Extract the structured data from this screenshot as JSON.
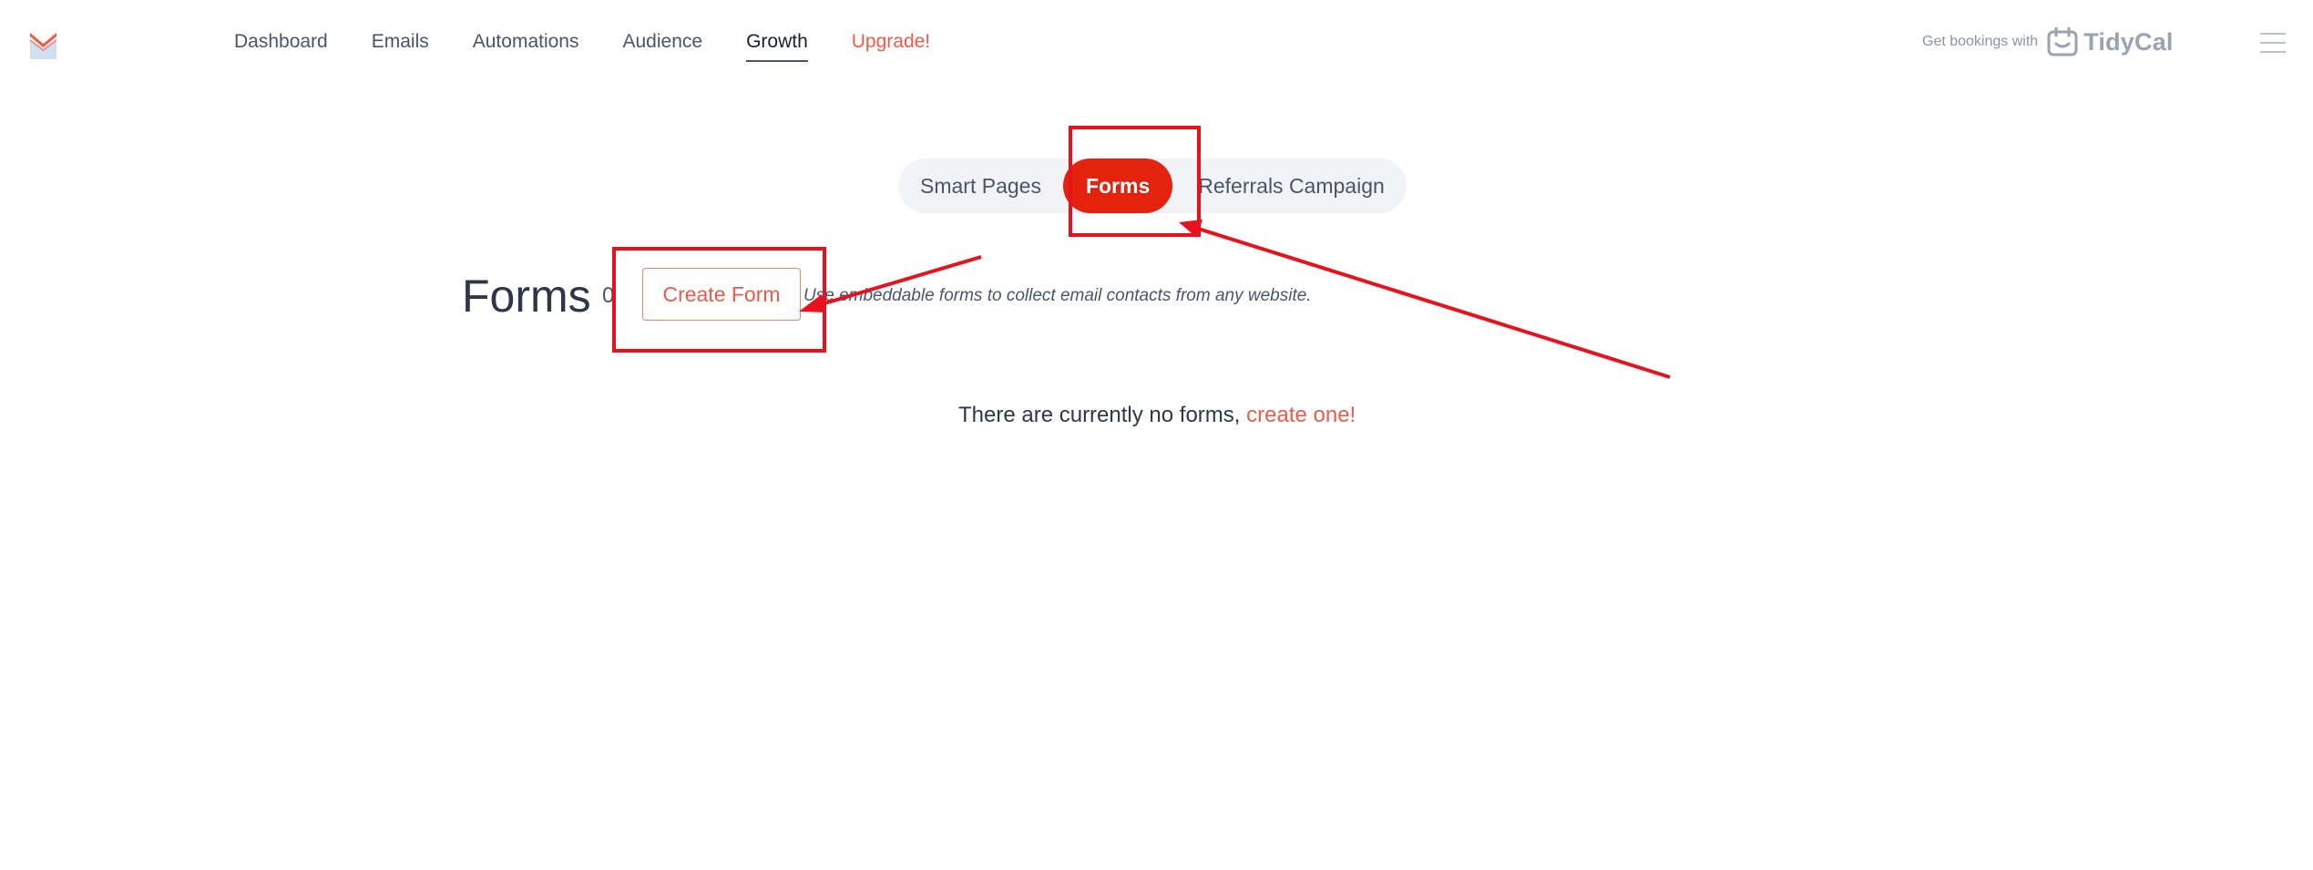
{
  "nav": {
    "items": [
      {
        "label": "Dashboard"
      },
      {
        "label": "Emails"
      },
      {
        "label": "Automations"
      },
      {
        "label": "Audience"
      },
      {
        "label": "Growth"
      },
      {
        "label": "Upgrade!"
      }
    ],
    "active": "Growth"
  },
  "tidycal": {
    "prefix": "Get bookings with",
    "brand": "TidyCal",
    "icon": "calendar-icon"
  },
  "tabs": [
    {
      "label": "Smart Pages"
    },
    {
      "label": "Forms"
    },
    {
      "label": "Referrals Campaign"
    }
  ],
  "main": {
    "title": "Forms",
    "count": "0",
    "create_button": "Create Form",
    "description": "Use embeddable forms to collect email contacts from any website.",
    "empty_text": "There are currently no forms,",
    "empty_link": "create one!"
  },
  "colors": {
    "accent": "#e3230e",
    "link": "#f05a4a",
    "annotation": "#e8121e"
  }
}
